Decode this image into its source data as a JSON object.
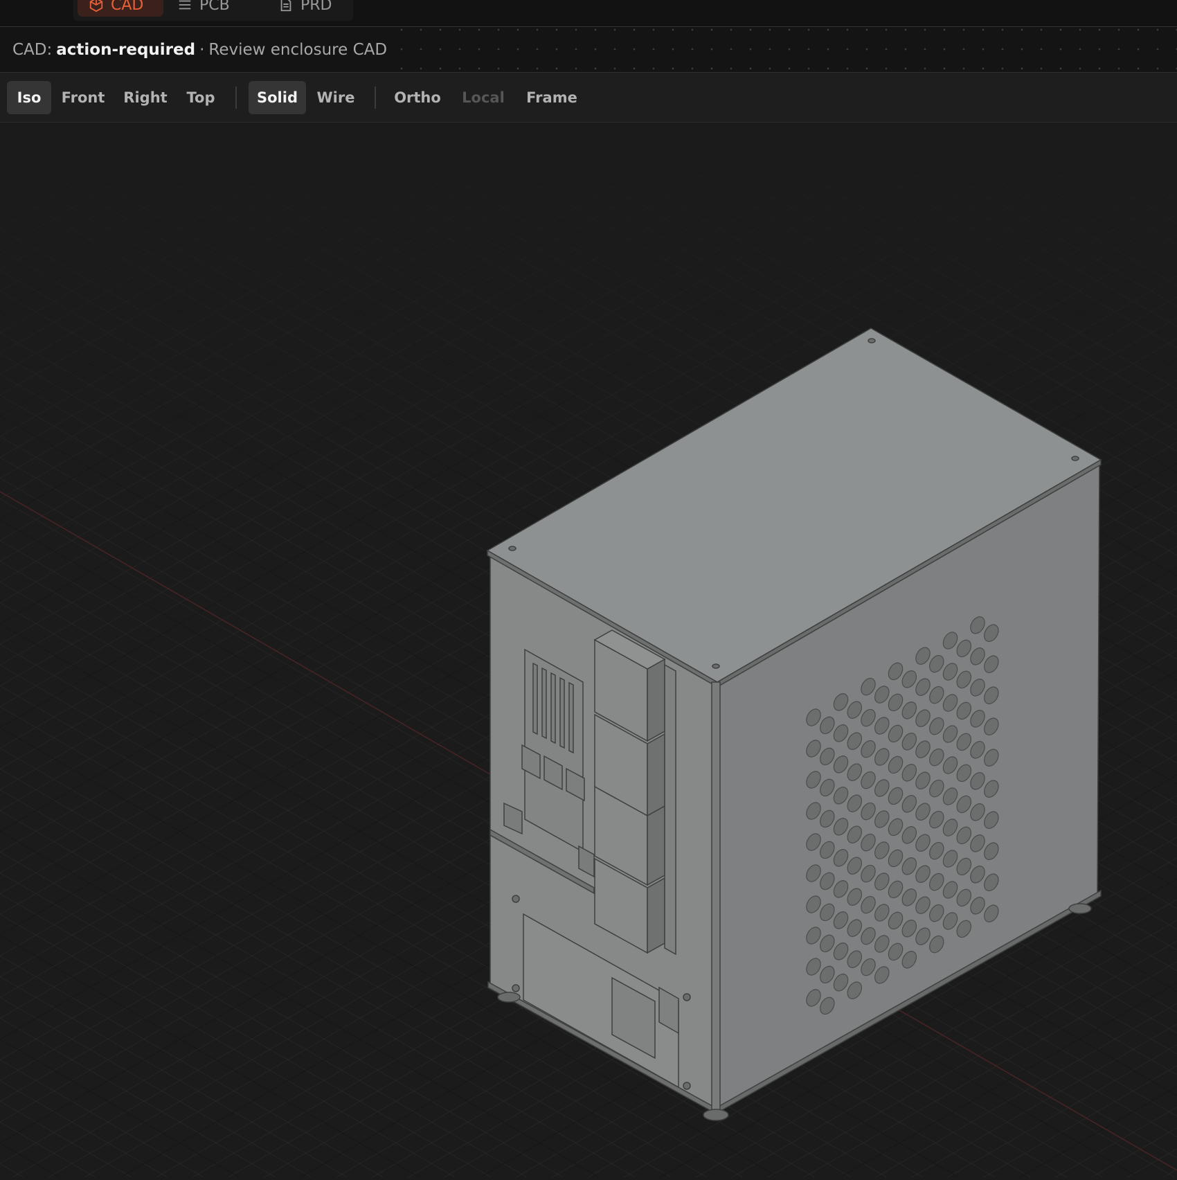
{
  "tabs": [
    {
      "label": "CAD",
      "icon": "cube-icon",
      "active": true
    },
    {
      "label": "PCB",
      "icon": "lines-icon",
      "active": false
    },
    {
      "label": "PRD",
      "icon": "document-icon",
      "active": false
    }
  ],
  "status": {
    "prefix": "CAD:",
    "state": "action-required",
    "separator": "·",
    "message": "Review enclosure CAD"
  },
  "toolbar": {
    "views": [
      "Iso",
      "Front",
      "Right",
      "Top"
    ],
    "active_view": "Iso",
    "render_modes": [
      "Solid",
      "Wire"
    ],
    "active_render": "Solid",
    "options": [
      "Ortho",
      "Local",
      "Frame"
    ],
    "disabled_option": "Local"
  },
  "colors": {
    "accent": "#e8603a",
    "background": "#1b1b1b",
    "model_top": "#8c8f8f",
    "model_front": "#858787",
    "model_side": "#7d7f80"
  }
}
